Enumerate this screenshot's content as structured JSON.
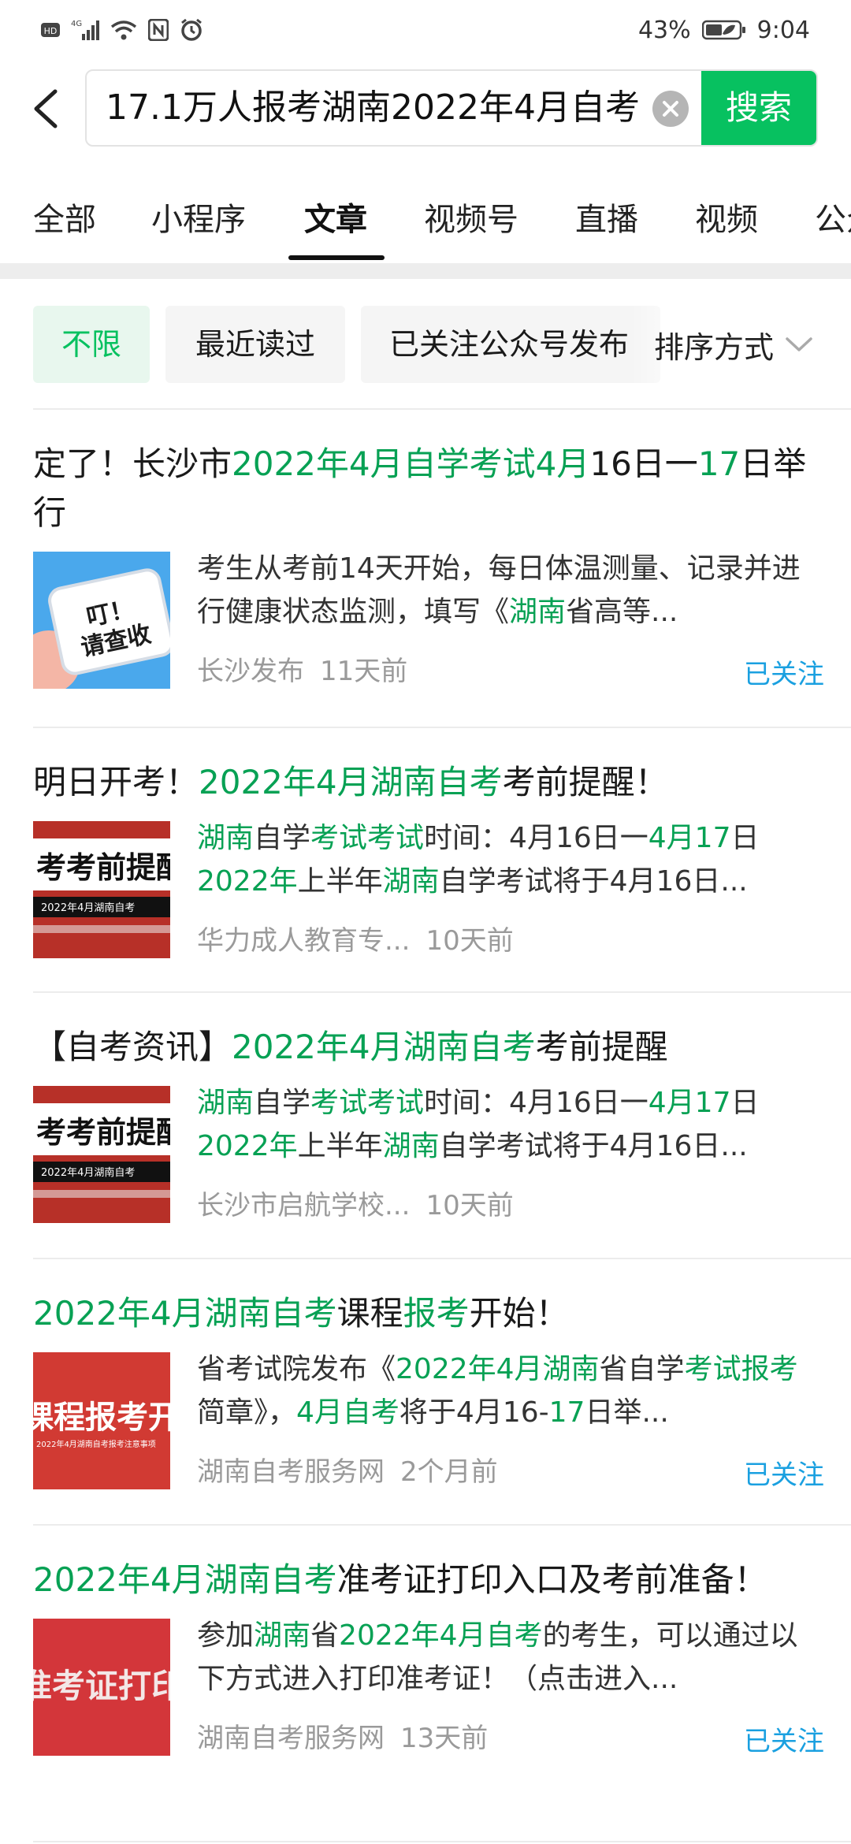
{
  "status_bar": {
    "left_badges": [
      "HD",
      "4G"
    ],
    "battery": "43%",
    "time": "9:04"
  },
  "search": {
    "query": "17.1万人报考湖南2022年4月自考",
    "button_label": "搜索"
  },
  "tabs": [
    {
      "label": "全部"
    },
    {
      "label": "小程序"
    },
    {
      "label": "文章"
    },
    {
      "label": "视频号"
    },
    {
      "label": "直播"
    },
    {
      "label": "视频"
    },
    {
      "label": "公众号"
    }
  ],
  "active_tab": "文章",
  "filters": {
    "chips": [
      "不限",
      "最近读过",
      "已关注公众号发布"
    ],
    "sort_label": "排序方式"
  },
  "articles": [
    {
      "title_parts": [
        {
          "t": "定了！长沙市",
          "hl": false
        },
        {
          "t": "2022年4月自学考试4月",
          "hl": true
        },
        {
          "t": "16日一",
          "hl": false
        },
        {
          "t": "17",
          "hl": true
        },
        {
          "t": "日举行",
          "hl": false
        }
      ],
      "thumb_text": "叮！请查收",
      "summary_parts": [
        {
          "t": "考生从考前14天开始，每日体温测量、记录并进行健康状态监测，填写《",
          "hl": false
        },
        {
          "t": "湖南",
          "hl": true
        },
        {
          "t": "省高等...",
          "hl": false
        }
      ],
      "source": "长沙发布",
      "time": "11天前",
      "followed": "已关注"
    },
    {
      "title_parts": [
        {
          "t": "明日开考！",
          "hl": false
        },
        {
          "t": "2022年4月湖南自考",
          "hl": true
        },
        {
          "t": "考前提醒！",
          "hl": false
        }
      ],
      "thumb_text": "考考前提醒",
      "thumb_sub": "2022年4月湖南自考",
      "summary_parts": [
        {
          "t": "湖南",
          "hl": true
        },
        {
          "t": "自学",
          "hl": false
        },
        {
          "t": "考试考试",
          "hl": true
        },
        {
          "t": "时间：4月16日一",
          "hl": false
        },
        {
          "t": "4月17",
          "hl": true
        },
        {
          "t": "日 ",
          "hl": false
        },
        {
          "t": "2022年",
          "hl": true
        },
        {
          "t": "上半年",
          "hl": false
        },
        {
          "t": "湖南",
          "hl": true
        },
        {
          "t": "自学考试将于4月16日...",
          "hl": false
        }
      ],
      "source": "华力成人教育专...",
      "time": "10天前",
      "followed": ""
    },
    {
      "title_parts": [
        {
          "t": "【自考资讯】",
          "hl": false
        },
        {
          "t": "2022年4月湖南自考",
          "hl": true
        },
        {
          "t": "考前提醒",
          "hl": false
        }
      ],
      "thumb_text": "考考前提醒",
      "thumb_sub": "2022年4月湖南自考",
      "summary_parts": [
        {
          "t": "湖南",
          "hl": true
        },
        {
          "t": "自学",
          "hl": false
        },
        {
          "t": "考试考试",
          "hl": true
        },
        {
          "t": "时间：4月16日一",
          "hl": false
        },
        {
          "t": "4月17",
          "hl": true
        },
        {
          "t": "日 ",
          "hl": false
        },
        {
          "t": "2022年",
          "hl": true
        },
        {
          "t": "上半年",
          "hl": false
        },
        {
          "t": "湖南",
          "hl": true
        },
        {
          "t": "自学考试将于4月16日...",
          "hl": false
        }
      ],
      "source": "长沙市启航学校...",
      "time": "10天前",
      "followed": ""
    },
    {
      "title_parts": [
        {
          "t": "2022年4月湖南自考",
          "hl": true
        },
        {
          "t": "课程",
          "hl": false
        },
        {
          "t": "报考",
          "hl": true
        },
        {
          "t": "开始！",
          "hl": false
        }
      ],
      "thumb_text": "课程报考开始",
      "thumb_sub": "2022年4月湖南自考报考注意事项",
      "summary_parts": [
        {
          "t": "省考试院发布《",
          "hl": false
        },
        {
          "t": "2022年4月湖南",
          "hl": true
        },
        {
          "t": "省自学",
          "hl": false
        },
        {
          "t": "考试报考",
          "hl": true
        },
        {
          "t": "简章》，",
          "hl": false
        },
        {
          "t": "4月自考",
          "hl": true
        },
        {
          "t": "将于4月16-",
          "hl": false
        },
        {
          "t": "17",
          "hl": true
        },
        {
          "t": "日举...",
          "hl": false
        }
      ],
      "source": "湖南自考服务网",
      "time": "2个月前",
      "followed": "已关注"
    },
    {
      "title_parts": [
        {
          "t": "2022年4月湖南自考",
          "hl": true
        },
        {
          "t": "准考证打印入口及考前准备！",
          "hl": false
        }
      ],
      "thumb_text": "准考证打印",
      "summary_parts": [
        {
          "t": "参加",
          "hl": false
        },
        {
          "t": "湖南",
          "hl": true
        },
        {
          "t": "省",
          "hl": false
        },
        {
          "t": "2022年4月自考",
          "hl": true
        },
        {
          "t": "的考生，可以通过以下方式进入打印准考证！（点击进入...",
          "hl": false
        }
      ],
      "source": "湖南自考服务网",
      "time": "13天前",
      "followed": "已关注"
    }
  ]
}
